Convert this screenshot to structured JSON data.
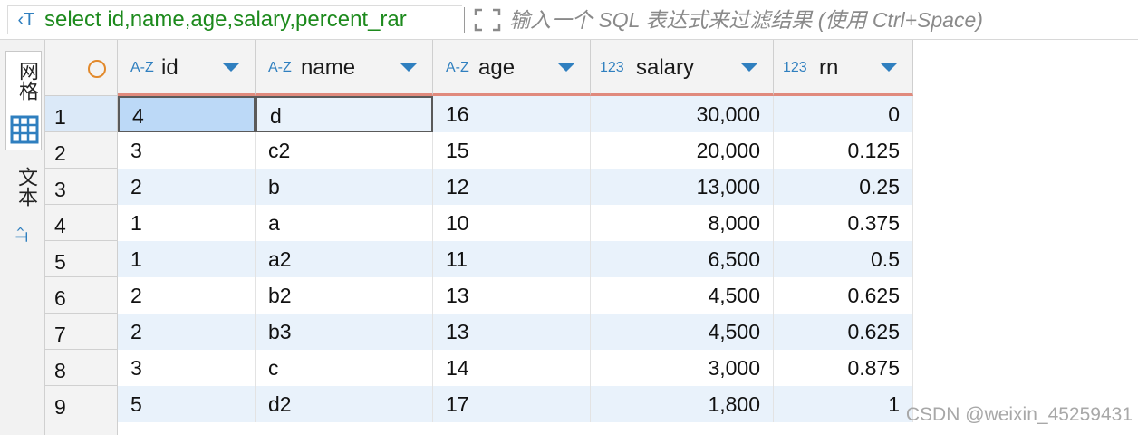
{
  "filter_bar": {
    "query_icon": "sql-text-icon",
    "query_text": "select id,name,age,salary,percent_rar",
    "expand_icon": "expand-icon",
    "placeholder": "输入一个 SQL 表达式来过滤结果 (使用 Ctrl+Space)"
  },
  "side_panel": {
    "grid_tab": "网格",
    "grid_icon": "grid-icon",
    "text_tab": "文本",
    "text_icon": "text-icon"
  },
  "columns": [
    {
      "type": "A-Z",
      "name": "id"
    },
    {
      "type": "A-Z",
      "name": "name"
    },
    {
      "type": "A-Z",
      "name": "age"
    },
    {
      "type": "123",
      "name": "salary"
    },
    {
      "type": "123",
      "name": "rn"
    }
  ],
  "rows": [
    {
      "num": "1",
      "id": "4",
      "name": "d",
      "age": "16",
      "salary": "30,000",
      "rn": "0"
    },
    {
      "num": "2",
      "id": "3",
      "name": "c2",
      "age": "15",
      "salary": "20,000",
      "rn": "0.125"
    },
    {
      "num": "3",
      "id": "2",
      "name": "b",
      "age": "12",
      "salary": "13,000",
      "rn": "0.25"
    },
    {
      "num": "4",
      "id": "1",
      "name": "a",
      "age": "10",
      "salary": "8,000",
      "rn": "0.375"
    },
    {
      "num": "5",
      "id": "1",
      "name": "a2",
      "age": "11",
      "salary": "6,500",
      "rn": "0.5"
    },
    {
      "num": "6",
      "id": "2",
      "name": "b2",
      "age": "13",
      "salary": "4,500",
      "rn": "0.625"
    },
    {
      "num": "7",
      "id": "2",
      "name": "b3",
      "age": "13",
      "salary": "4,500",
      "rn": "0.625"
    },
    {
      "num": "8",
      "id": "3",
      "name": "c",
      "age": "14",
      "salary": "3,000",
      "rn": "0.875"
    },
    {
      "num": "9",
      "id": "5",
      "name": "d2",
      "age": "17",
      "salary": "1,800",
      "rn": "1"
    }
  ],
  "watermark": "CSDN @weixin_45259431",
  "colors": {
    "query_text": "#1d8a1d",
    "accent": "#2f7fbf",
    "header_underline": "#e08a7d",
    "selected_cell": "#bcd9f7",
    "alt_row": "#e9f2fb"
  }
}
